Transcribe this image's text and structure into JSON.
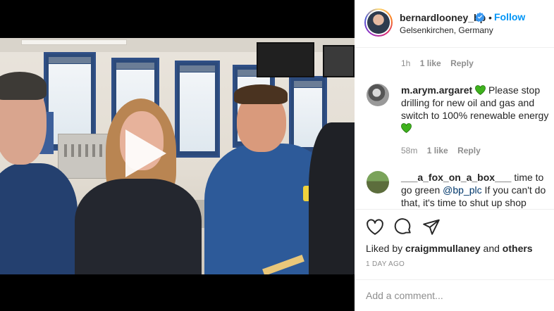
{
  "post": {
    "username": "bernardlooney_bp",
    "separator": "•",
    "follow_label": "Follow",
    "location": "Gelsenkirchen, Germany",
    "icons": {
      "verified": "verified-badge-icon",
      "play": "play-icon"
    }
  },
  "comments": [
    {
      "username": "",
      "text": "",
      "age": "1h",
      "likes": "1 like",
      "reply_label": "Reply"
    },
    {
      "username": "m.arym.argaret",
      "text_before": "",
      "text": "Please stop drilling for new oil and gas and switch to 100% renewable energy",
      "emoji": "green-heart",
      "age": "58m",
      "likes": "1 like",
      "reply_label": "Reply"
    },
    {
      "username": "___a_fox_on_a_box___",
      "text_a": "time to go green",
      "mention": "@bp_plc",
      "text_b": "If you can't do that, it's time to shut up shop"
    }
  ],
  "actions": {
    "icons": [
      "heart-icon",
      "comment-icon",
      "share-icon"
    ],
    "liked_by_prefix": "Liked by",
    "liked_by_user": "craigmmullaney",
    "liked_by_and": "and",
    "liked_by_others": "others",
    "timestamp": "1 day ago"
  },
  "add_comment": {
    "placeholder": "Add a comment..."
  },
  "colors": {
    "accent": "#0095f6",
    "text": "#262626",
    "muted": "#8e8e8e",
    "mention": "#00376b",
    "emoji_green": "#3fb21d",
    "divider": "#efefef"
  }
}
